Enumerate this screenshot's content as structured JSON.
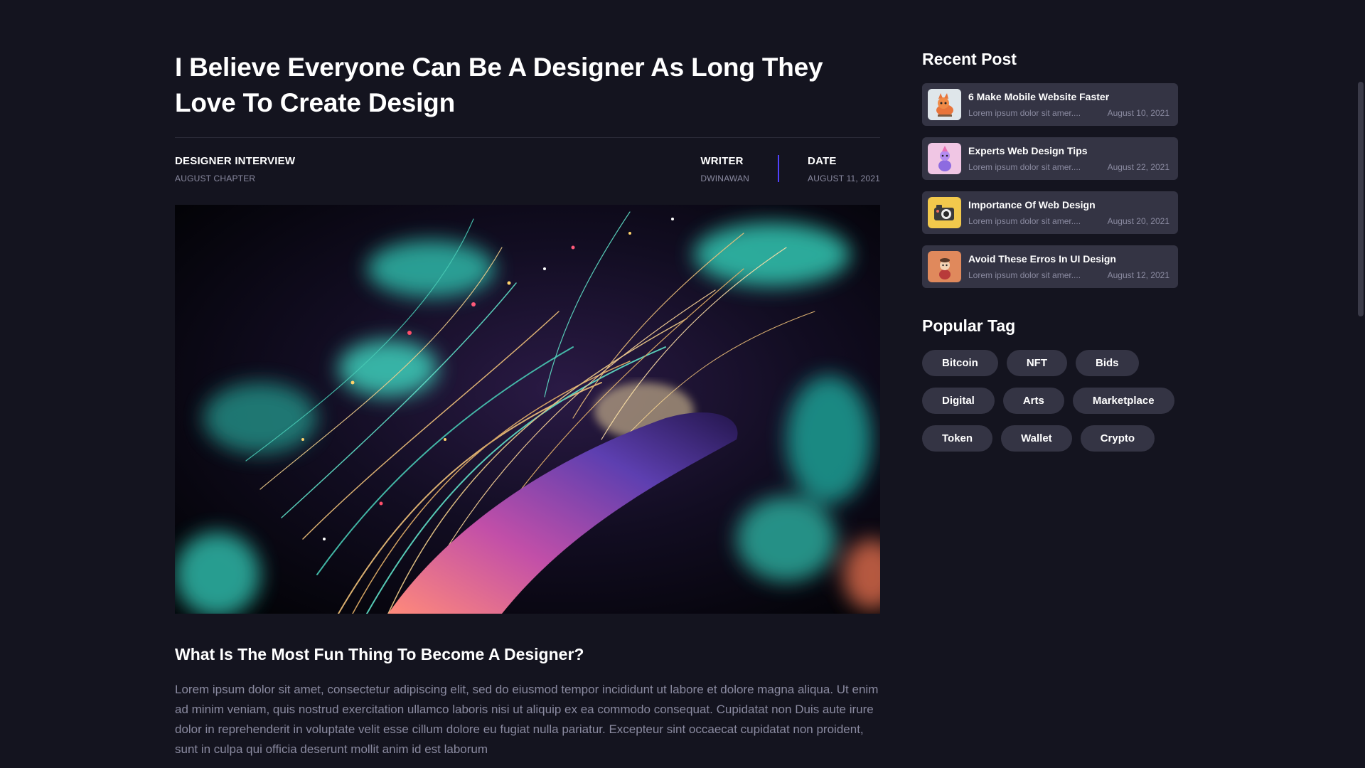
{
  "article": {
    "title": "I Believe Everyone Can Be A Designer As Long They Love To Create Design",
    "category": {
      "label": "DESIGNER INTERVIEW",
      "sub": "AUGUST CHAPTER"
    },
    "writer": {
      "label": "WRITER",
      "value": "DWINAWAN"
    },
    "date": {
      "label": "DATE",
      "value": "AUGUST 11, 2021"
    },
    "hero_image": "abstract-neon-feather-artwork",
    "subheading": "What Is The Most Fun Thing To Become A Designer?",
    "body": "Lorem ipsum dolor sit amet, consectetur adipiscing elit, sed do eiusmod tempor incididunt ut labore et dolore magna aliqua. Ut enim ad minim veniam, quis nostrud exercitation ullamco laboris nisi ut aliquip ex ea commodo consequat. Cupidatat non Duis aute irure dolor in reprehenderit in voluptate velit esse cillum dolore eu fugiat nulla pariatur. Excepteur sint occaecat cupidatat non proident, sunt in culpa qui officia deserunt mollit anim id est laborum"
  },
  "sidebar": {
    "recent_heading": "Recent Post",
    "recent_posts": [
      {
        "title": "6 Make Mobile Website Faster",
        "excerpt": "Lorem ipsum dolor sit amer....",
        "date": "August 10, 2021",
        "thumb": "fox-3d-thumb"
      },
      {
        "title": "Experts Web Design Tips",
        "excerpt": "Lorem ipsum dolor sit amer....",
        "date": "August 22, 2021",
        "thumb": "character-pink-thumb"
      },
      {
        "title": "Importance Of Web Design",
        "excerpt": "Lorem ipsum dolor sit amer....",
        "date": "August 20, 2021",
        "thumb": "camera-yellow-thumb"
      },
      {
        "title": "Avoid These Erros In UI Design",
        "excerpt": "Lorem ipsum dolor sit amer....",
        "date": "August 12, 2021",
        "thumb": "figure-orange-thumb"
      }
    ],
    "tag_heading": "Popular Tag",
    "tags": [
      [
        "Bitcoin",
        "NFT",
        "Bids"
      ],
      [
        "Digital",
        "Arts",
        "Marketplace"
      ],
      [
        "Token",
        "Wallet",
        "Crypto"
      ]
    ]
  },
  "colors": {
    "background": "#14141f",
    "card": "#343444",
    "muted_text": "#8a8aa0",
    "accent": "#5142fc"
  }
}
